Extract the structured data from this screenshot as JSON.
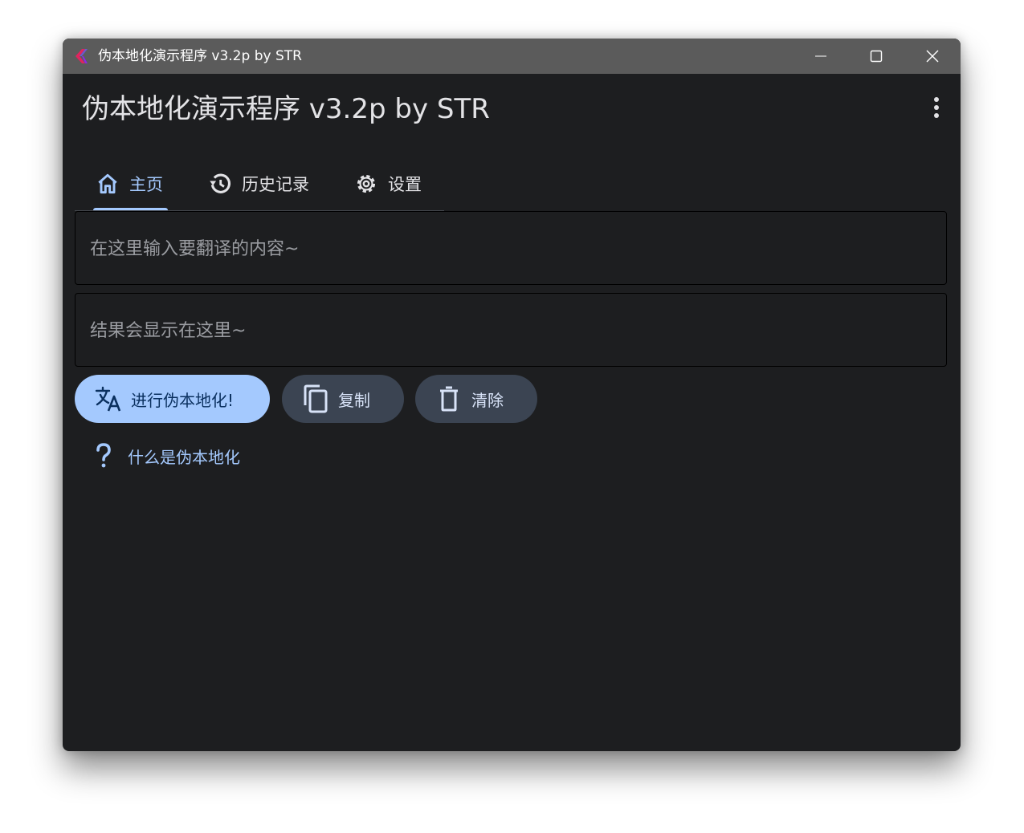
{
  "window": {
    "title": "伪本地化演示程序 v3.2p by STR",
    "icon": "app-logo-icon",
    "controls": [
      "minimize-icon",
      "maximize-icon",
      "close-icon"
    ]
  },
  "appbar": {
    "title": "伪本地化演示程序 v3.2p by STR",
    "menu_icon": "more-vert-icon"
  },
  "tabs": [
    {
      "label": "主页",
      "icon": "home-icon",
      "selected": true
    },
    {
      "label": "历史记录",
      "icon": "history-icon",
      "selected": false
    },
    {
      "label": "设置",
      "icon": "gear-icon",
      "selected": false
    }
  ],
  "input": {
    "value": "",
    "placeholder": "在这里输入要翻译的内容~"
  },
  "output": {
    "value": "",
    "placeholder": "结果会显示在这里~"
  },
  "actions": {
    "localize_label": "进行伪本地化!",
    "copy_label": "复制",
    "clear_label": "清除"
  },
  "help": {
    "label": "什么是伪本地化",
    "icon": "question-mark-icon"
  },
  "colors": {
    "background": "#1d1e20",
    "titlebar": "#5b5b5b",
    "accent": "#a4c9fe",
    "tonal_button": "#3b4452",
    "text": "#e3e3e6",
    "placeholder": "#9a9ca1"
  }
}
